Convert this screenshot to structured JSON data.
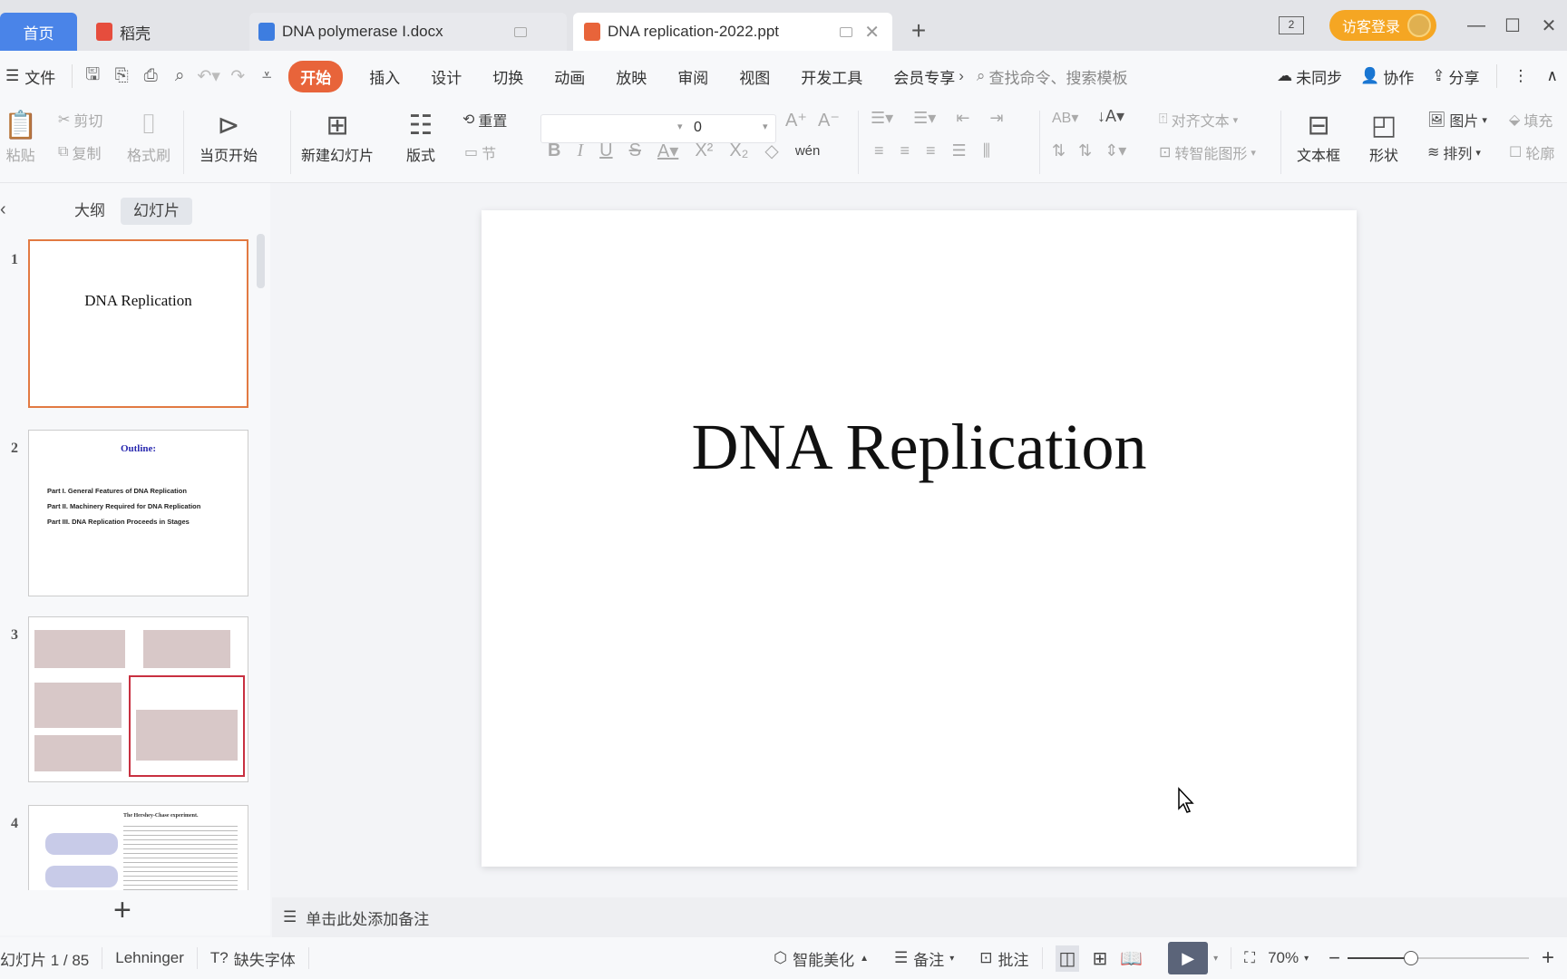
{
  "tabs": {
    "home": "首页",
    "daoke": "稻壳",
    "docx": "DNA polymerase I.docx",
    "ppt": "DNA replication-2022.ppt",
    "new_tab": "+"
  },
  "window": {
    "login": "访客登录",
    "window_count": "2",
    "minimize": "—",
    "maximize": "☐",
    "close": "✕"
  },
  "menu": {
    "file": "文件",
    "items": [
      "开始",
      "插入",
      "设计",
      "切换",
      "动画",
      "放映",
      "审阅",
      "视图",
      "开发工具",
      "会员专享"
    ],
    "search_placeholder": "查找命令、搜索模板",
    "sync": "未同步",
    "collab": "协作",
    "share": "分享"
  },
  "ribbon": {
    "paste": "粘贴",
    "cut": "剪切",
    "copy": "复制",
    "format_painter": "格式刷",
    "play_from_current": "当页开始",
    "new_slide": "新建幻灯片",
    "layout": "版式",
    "reset": "重置",
    "section": "节",
    "font_name": "",
    "font_size": "0",
    "align_text": "对齐文本",
    "smartart": "转智能图形",
    "textbox": "文本框",
    "shape": "形状",
    "picture": "图片",
    "arrange": "排列",
    "fill": "填充",
    "outline": "轮廓",
    "phonetic": "wén"
  },
  "left_panel": {
    "tab_outline": "大纲",
    "tab_slides": "幻灯片",
    "slides": [
      {
        "number": "1",
        "title": "DNA Replication"
      },
      {
        "number": "2",
        "title": "Outline:",
        "lines": [
          "Part I. General Features of DNA Replication",
          "Part II. Machinery Required for DNA Replication",
          "Part III. DNA Replication Proceeds in Stages"
        ]
      },
      {
        "number": "3"
      },
      {
        "number": "4",
        "title": "The Hershey-Chase experiment."
      }
    ],
    "add_slide": "+"
  },
  "slide": {
    "title": "DNA Replication"
  },
  "notes": {
    "placeholder": "单击此处添加备注"
  },
  "status": {
    "slide_counter": "幻灯片 1 / 85",
    "theme": "Lehninger",
    "missing_font": "缺失字体",
    "beautify": "智能美化",
    "notes": "备注",
    "comment": "批注",
    "zoom": "70%",
    "zoom_value": 0.35
  },
  "colors": {
    "accent": "#e8643a",
    "home_tab": "#4a84e8",
    "login": "#f5a623",
    "selected_thumb": "#e27a42"
  }
}
